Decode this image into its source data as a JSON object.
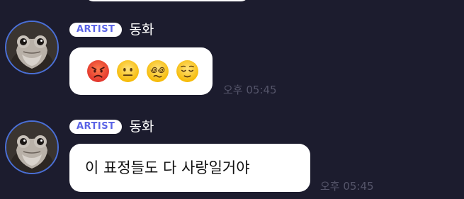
{
  "messages": [
    {
      "badge": "ARTIST",
      "sender": "동화",
      "content_type": "emoji",
      "emojis": [
        "angry-face",
        "neutral-face",
        "face-with-spiral-eyes",
        "relieved-face"
      ],
      "time": "오후 05:45"
    },
    {
      "badge": "ARTIST",
      "sender": "동화",
      "content_type": "text",
      "text": "이 표정들도 다 사랑일거야",
      "time": "오후 05:45"
    }
  ],
  "colors": {
    "background": "#1c1c2e",
    "badge_text": "#5a63e6",
    "avatar_ring": "#4a6fd6",
    "timestamp": "#55556a"
  }
}
